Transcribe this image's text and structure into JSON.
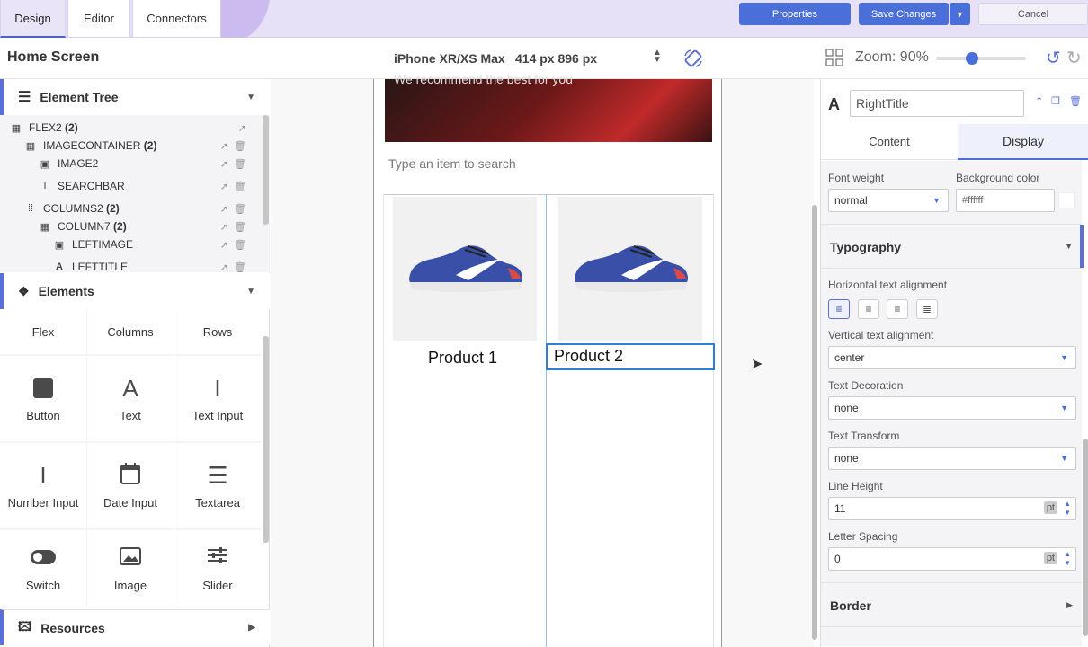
{
  "tabs": [
    {
      "label": "Design",
      "active": true
    },
    {
      "label": "Editor",
      "active": false
    },
    {
      "label": "Connectors",
      "active": false
    }
  ],
  "actions": {
    "properties": "Properties",
    "save": "Save Changes",
    "cancel": "Cancel"
  },
  "toolbar": {
    "screen_name": "Home Screen",
    "device": "iPhone XR/XS Max",
    "device_size": "414 px 896 px",
    "zoom_label": "Zoom: 90%",
    "zoom_percent": 90
  },
  "element_tree": {
    "title": "Element Tree",
    "items": [
      {
        "name": "FLEX2",
        "count": "(2)"
      },
      {
        "name": "IMAGECONTAINER",
        "count": "(2)"
      },
      {
        "name": "IMAGE2",
        "count": ""
      },
      {
        "name": "SEARCHBAR",
        "count": ""
      },
      {
        "name": "COLUMNS2",
        "count": "(2)"
      },
      {
        "name": "COLUMN7",
        "count": "(2)"
      },
      {
        "name": "LEFTIMAGE",
        "count": ""
      },
      {
        "name": "LEFTTITLE",
        "count": ""
      }
    ]
  },
  "elements": {
    "title": "Elements",
    "layout": [
      "Flex",
      "Columns",
      "Rows"
    ],
    "items": [
      "Button",
      "Text",
      "Text Input",
      "Number Input",
      "Date Input",
      "Textarea",
      "Switch",
      "Image",
      "Slider"
    ]
  },
  "resources": {
    "title": "Resources"
  },
  "canvas": {
    "hero_text": "We recommend the best for you",
    "search_placeholder": "Type an item to search",
    "products": [
      "Product 1",
      "Product 2"
    ]
  },
  "inspector": {
    "component_name": "RightTitle",
    "tabs": {
      "content": "Content",
      "display": "Display"
    },
    "font_weight_label": "Font weight",
    "font_weight": "normal",
    "bg_color_label": "Background color",
    "bg_color": "#ffffff",
    "typography": "Typography",
    "h_align_label": "Horizontal text alignment",
    "v_align_label": "Vertical text alignment",
    "v_align": "center",
    "decoration_label": "Text Decoration",
    "decoration": "none",
    "transform_label": "Text Transform",
    "transform": "none",
    "line_height_label": "Line Height",
    "line_height": "11",
    "letter_spacing_label": "Letter Spacing",
    "letter_spacing": "0",
    "unit": "pt",
    "border": "Border"
  },
  "colors": {
    "accent": "#4b6fd8",
    "top_bar": "#e7e1f8"
  }
}
